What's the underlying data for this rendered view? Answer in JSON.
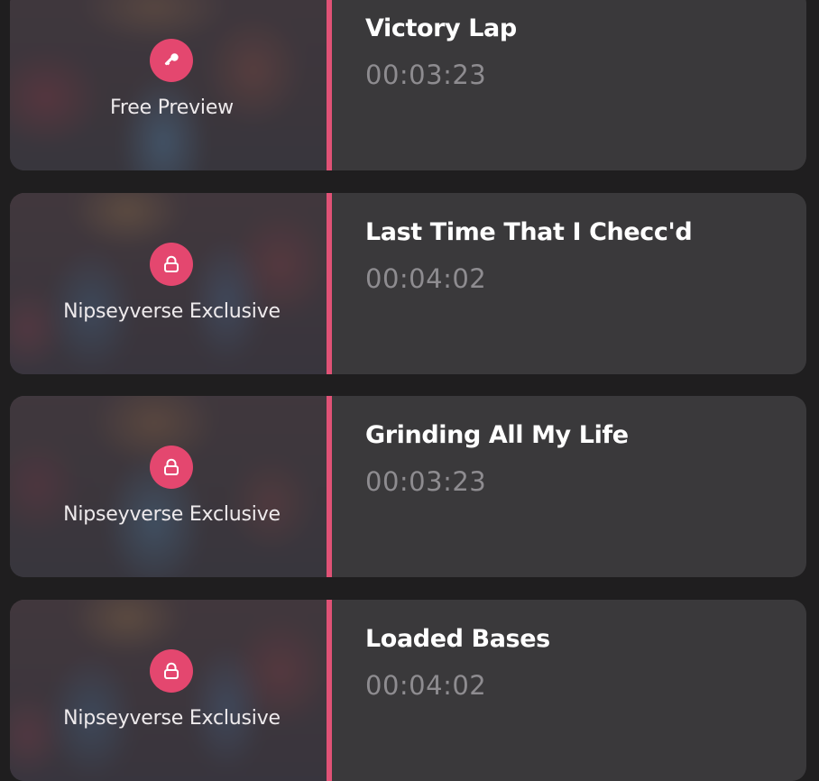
{
  "tracks": [
    {
      "title": "Victory Lap",
      "duration": "00:03:23",
      "access_label": "Free Preview",
      "access_icon": "key-icon"
    },
    {
      "title": "Last Time That I Checc'd",
      "duration": "00:04:02",
      "access_label": "Nipseyverse Exclusive",
      "access_icon": "lock-icon"
    },
    {
      "title": "Grinding All My Life",
      "duration": "00:03:23",
      "access_label": "Nipseyverse Exclusive",
      "access_icon": "lock-icon"
    },
    {
      "title": "Loaded Bases",
      "duration": "00:04:02",
      "access_label": "Nipseyverse Exclusive",
      "access_icon": "lock-icon"
    }
  ],
  "colors": {
    "accent": "#e4476f",
    "card_background": "#3a393b",
    "page_background": "#1f1e1f",
    "title_text": "#ffffff",
    "duration_text": "#8e8c90"
  }
}
